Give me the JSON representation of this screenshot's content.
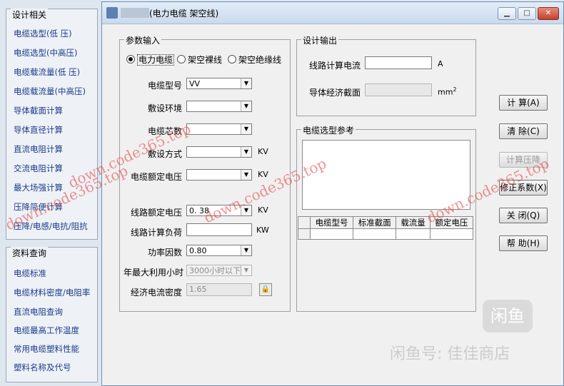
{
  "left_panel": {
    "design_group_title": "设计相关",
    "design_items": [
      "电缆选型(低 压)",
      "电缆选型(中高压)",
      "电缆载流量(低 压)",
      "电缆载流量(中高压)",
      "导体截面计算",
      "导体直径计算",
      "直流电阻计算",
      "交流电阻计算",
      "最大场强计算",
      "压降简便计算",
      "压降/电感/电抗/阻抗"
    ],
    "data_group_title": "资料查询",
    "data_items": [
      "电缆标准",
      "电缆材料密度/电阻率",
      "直流电阻查询",
      "电缆最高工作温度",
      "常用电缆塑料性能",
      "塑料名称及代号"
    ]
  },
  "window": {
    "title": "(电力电缆 架空线)",
    "min_label": "▁",
    "max_label": "□",
    "close_label": "✕"
  },
  "params": {
    "legend": "参数输入",
    "radios": [
      "电力电缆",
      "架空裸线",
      "架空绝缘线"
    ],
    "selected_radio": 0,
    "cable_model_label": "电缆型号",
    "cable_model_value": "VV",
    "env_label": "敷设环境",
    "env_value": "",
    "cores_label": "电缆芯数",
    "cores_value": "",
    "method_label": "敷设方式",
    "method_value": "",
    "method_unit": "KV",
    "rated_v_label": "电缆额定电压",
    "rated_v_value": "",
    "rated_v_unit": "KV",
    "line_v_label": "线路额定电压",
    "line_v_value": "0. 38",
    "line_v_unit": "KV",
    "load_label": "线路计算负荷",
    "load_value": "",
    "load_unit": "KW",
    "pf_label": "功率因数",
    "pf_value": "0.80",
    "hours_label": "年最大利用小时",
    "hours_value": "3000小时以下",
    "density_label": "经济电流密度",
    "density_value": "1.65",
    "lock_icon": "🔒"
  },
  "output": {
    "legend": "设计输出",
    "current_label": "线路计算电流",
    "current_value": "",
    "current_unit": "A",
    "section_label": "导体经济截面",
    "section_value": "",
    "section_unit": "mm",
    "section_sup": "2"
  },
  "reference": {
    "legend": "电缆选型参考",
    "columns": [
      "",
      "电缆型号",
      "标准截面",
      "载流量",
      "额定电压"
    ]
  },
  "buttons": {
    "calc": "计 算(A)",
    "clear": "清 除(C)",
    "voltage_drop": "计算压降",
    "correction": "修正系数(X)",
    "close": "关 闭(Q)",
    "help": "帮 助(H)"
  },
  "watermarks": {
    "text1": "down.code365.top",
    "text2": "down.code365.top",
    "text3": "down.code365.top",
    "text4": "down.code365.top",
    "xianyu_logo": "闲鱼",
    "xianyu_text": "闲鱼号: 佳佳商店"
  }
}
